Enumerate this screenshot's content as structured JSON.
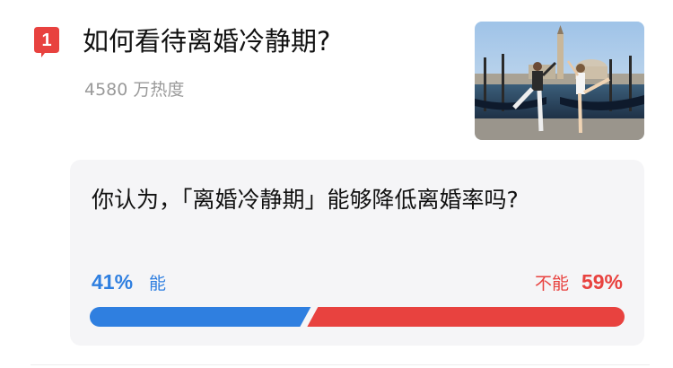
{
  "item": {
    "rank": "1",
    "title": "如何看待离婚冷静期?",
    "heat": "4580 万热度",
    "badge_color": "#e8423f"
  },
  "poll": {
    "question": "你认为，「离婚冷静期」能够降低离婚率吗?",
    "options": [
      {
        "label": "能",
        "percent": "41%",
        "value": 0.41,
        "color": "#2f7fe0"
      },
      {
        "label": "不能",
        "percent": "59%",
        "value": 0.59,
        "color": "#e8423f"
      }
    ]
  }
}
